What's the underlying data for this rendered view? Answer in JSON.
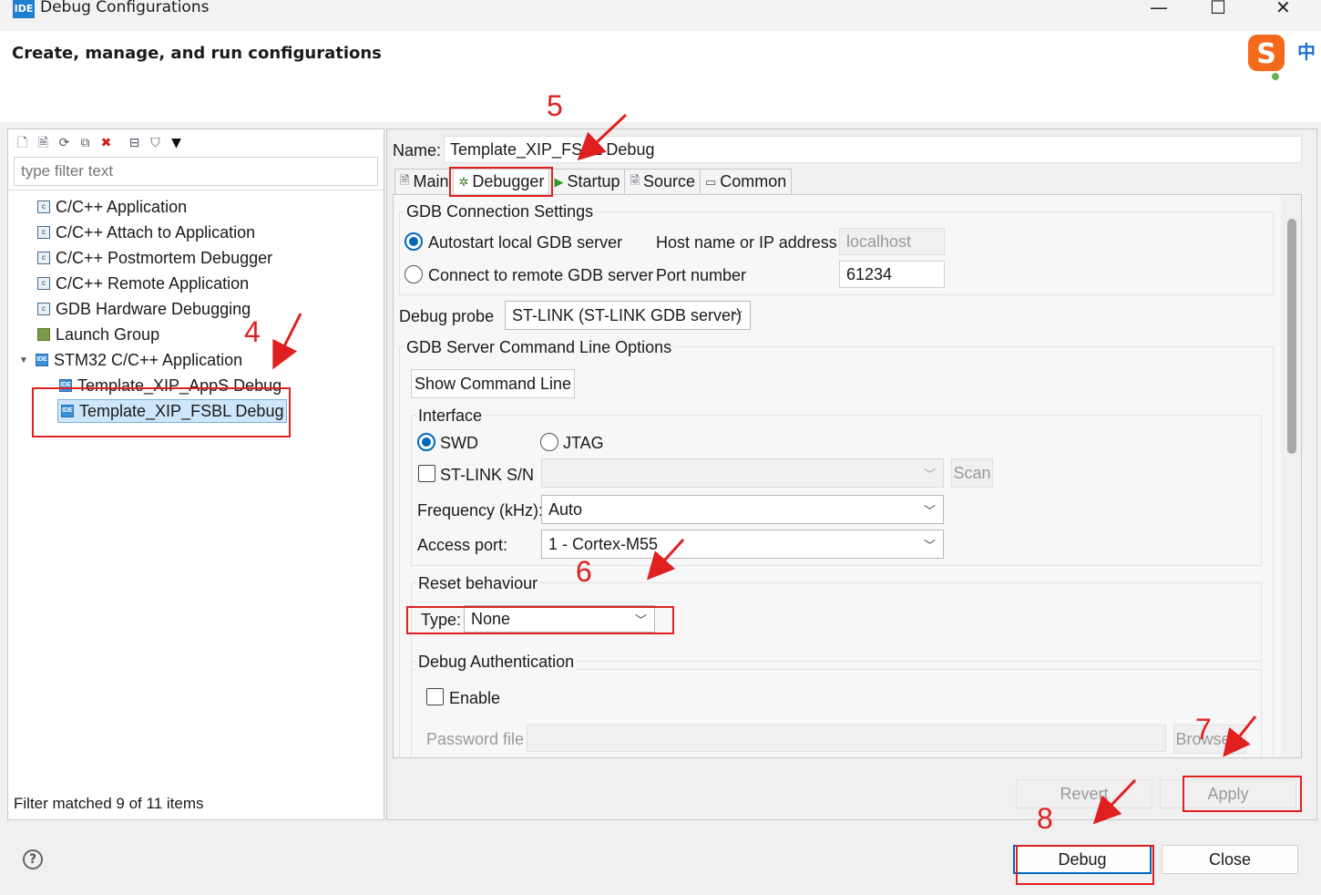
{
  "window": {
    "app_icon_text": "IDE",
    "title": "Debug Configurations",
    "minimize": "—",
    "maximize": "☐",
    "close": "✕"
  },
  "header": {
    "title": "Create, manage, and run configurations",
    "ime_label": "中"
  },
  "left": {
    "filter_placeholder": "type filter text",
    "tree": [
      {
        "label": "C/C++ Application"
      },
      {
        "label": "C/C++ Attach to Application"
      },
      {
        "label": "C/C++ Postmortem Debugger"
      },
      {
        "label": "C/C++ Remote Application"
      },
      {
        "label": "GDB Hardware Debugging"
      },
      {
        "label": "Launch Group"
      },
      {
        "label": "STM32 C/C++ Application"
      },
      {
        "label": "Template_XIP_AppS Debug"
      },
      {
        "label": "Template_XIP_FSBL Debug"
      }
    ],
    "status": "Filter matched 9 of 11 items"
  },
  "right": {
    "name_label": "Name:",
    "name_value": "Template_XIP_FSBL Debug",
    "tabs": [
      "Main",
      "Debugger",
      "Startup",
      "Source",
      "Common"
    ],
    "gdb_connection": {
      "title": "GDB Connection Settings",
      "autostart_label": "Autostart local GDB server",
      "connect_label": "Connect to remote GDB server",
      "host_label": "Host name or IP address",
      "host_value": "localhost",
      "port_label": "Port number",
      "port_value": "61234"
    },
    "debug_probe": {
      "label": "Debug probe",
      "value": "ST-LINK (ST-LINK GDB server)"
    },
    "gdb_server": {
      "title": "GDB Server Command Line Options",
      "show_cmd_button": "Show Command Line"
    },
    "interface": {
      "title": "Interface",
      "swd": "SWD",
      "jtag": "JTAG",
      "stlink_sn_label": "ST-LINK S/N",
      "scan_button": "Scan",
      "frequency_label": "Frequency (kHz):",
      "frequency_value": "Auto",
      "access_port_label": "Access port:",
      "access_port_value": "1 - Cortex-M55"
    },
    "reset": {
      "title": "Reset behaviour",
      "type_label": "Type:",
      "type_value": "None"
    },
    "debug_auth": {
      "title": "Debug Authentication",
      "enable_label": "Enable",
      "password_label": "Password file",
      "browse_button": "Browse..."
    },
    "revert_button": "Revert",
    "apply_button": "Apply"
  },
  "bottom": {
    "help_label": "?",
    "debug_button": "Debug",
    "close_button": "Close"
  },
  "annotations": [
    "4",
    "5",
    "6",
    "7",
    "8"
  ],
  "colors": {
    "annotation": "#e02020",
    "accent": "#0067c0"
  }
}
